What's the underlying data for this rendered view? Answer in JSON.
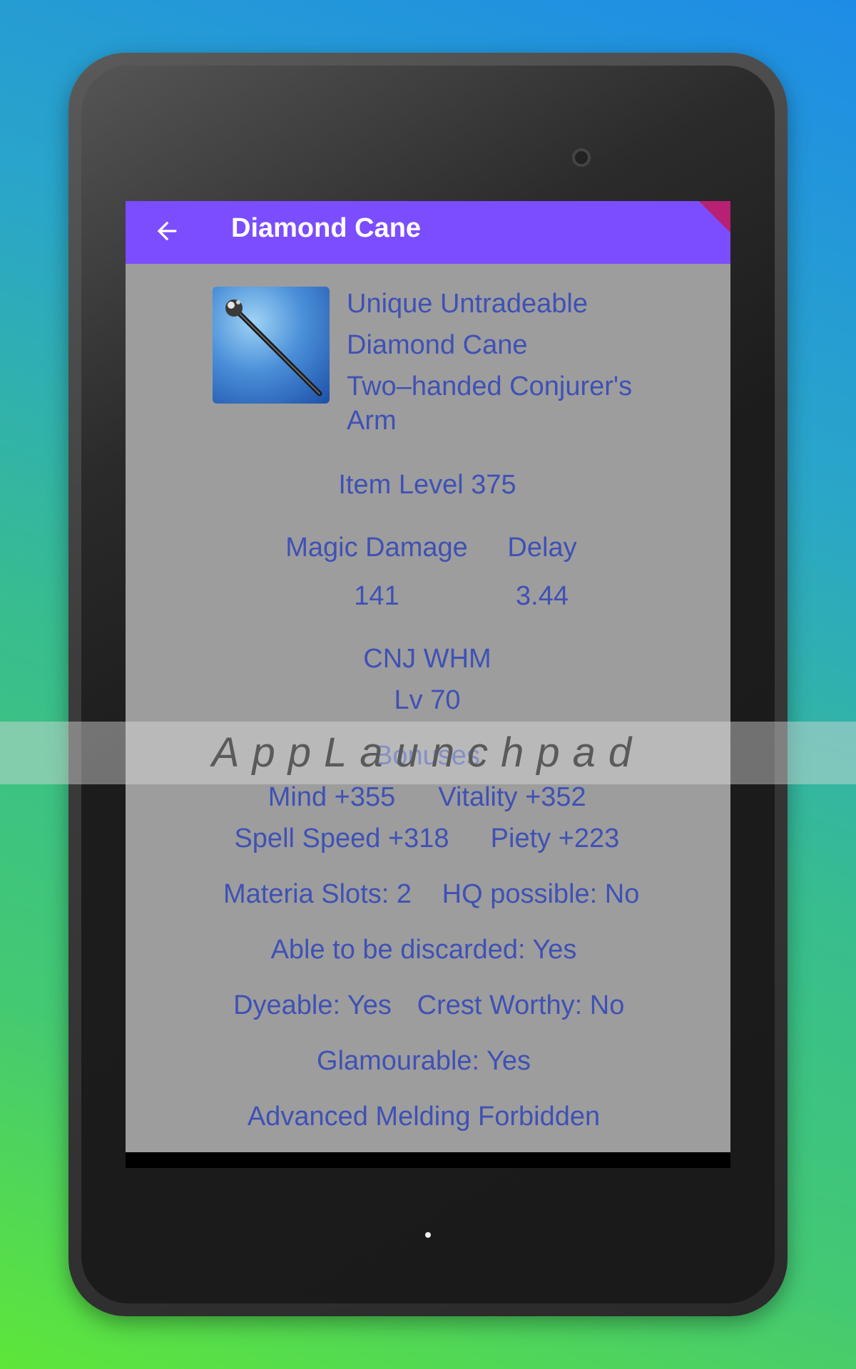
{
  "appbar": {
    "title": "Diamond Cane",
    "back_icon": "arrow-left-icon",
    "color": "#7c4dff"
  },
  "item": {
    "icon": "cane-icon",
    "tags": "Unique  Untradeable",
    "name": "Diamond Cane",
    "category_line1": "Two–handed Conjurer's",
    "category_line2": "Arm",
    "item_level": "Item Level 375"
  },
  "stats": {
    "damage_label": "Magic Damage",
    "delay_label": "Delay",
    "damage_value": "141",
    "delay_value": "3.44"
  },
  "requirements": {
    "classes": "CNJ WHM",
    "level": "Lv 70"
  },
  "bonuses": {
    "heading": "Bonuses",
    "row1_left": "Mind +355",
    "row1_right": "Vitality +352",
    "row2_left": "Spell Speed +318",
    "row2_right": "Piety +223"
  },
  "properties": {
    "materia": "Materia Slots: 2",
    "hq": "HQ possible: No",
    "discard": "Able to be discarded: Yes",
    "dyeable": "Dyeable: Yes",
    "crest": "Crest Worthy: No",
    "glamour": "Glamourable: Yes",
    "melding": "Advanced Melding Forbidden"
  },
  "watermark": {
    "text": "AppLaunchpad"
  },
  "colors": {
    "text": "#3f51b5",
    "screen_bg": "#9d9d9d"
  }
}
